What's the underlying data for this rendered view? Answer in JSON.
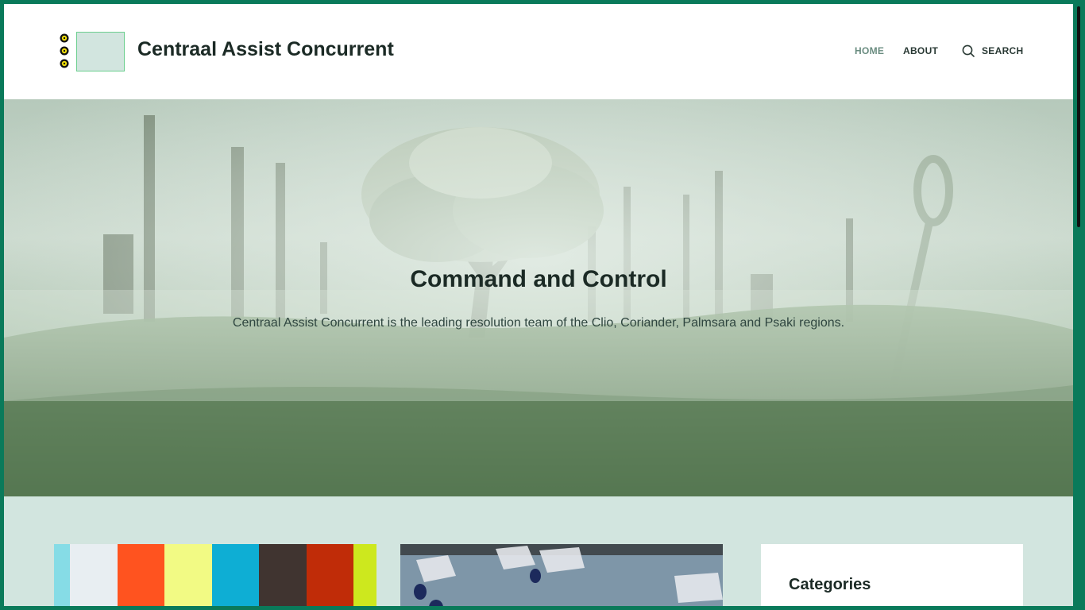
{
  "header": {
    "site_title": "Centraal Assist Concurrent",
    "nav": [
      {
        "label": "HOME",
        "active": true
      },
      {
        "label": "ABOUT",
        "active": false
      }
    ],
    "search_label": "SEARCH"
  },
  "hero": {
    "title": "Command and Control",
    "subtitle": "Centraal Assist Concurrent is the leading resolution team of the Clio, Coriander, Palmsara and Psaki regions."
  },
  "palette_card": {
    "colors": [
      "#86dce6",
      "#e8eef2",
      "#ff531f",
      "#f2fa84",
      "#0eaed4",
      "#403430",
      "#c02c08",
      "#cde81e"
    ]
  },
  "sidebar": {
    "widget_title": "Categories"
  },
  "colors": {
    "frame": "#0a7a5a",
    "background": "#d2e5df",
    "text": "#1b2a25",
    "nav_active": "#6a8c80"
  },
  "icons": {
    "logo": "flower-icon",
    "search": "search-icon"
  }
}
